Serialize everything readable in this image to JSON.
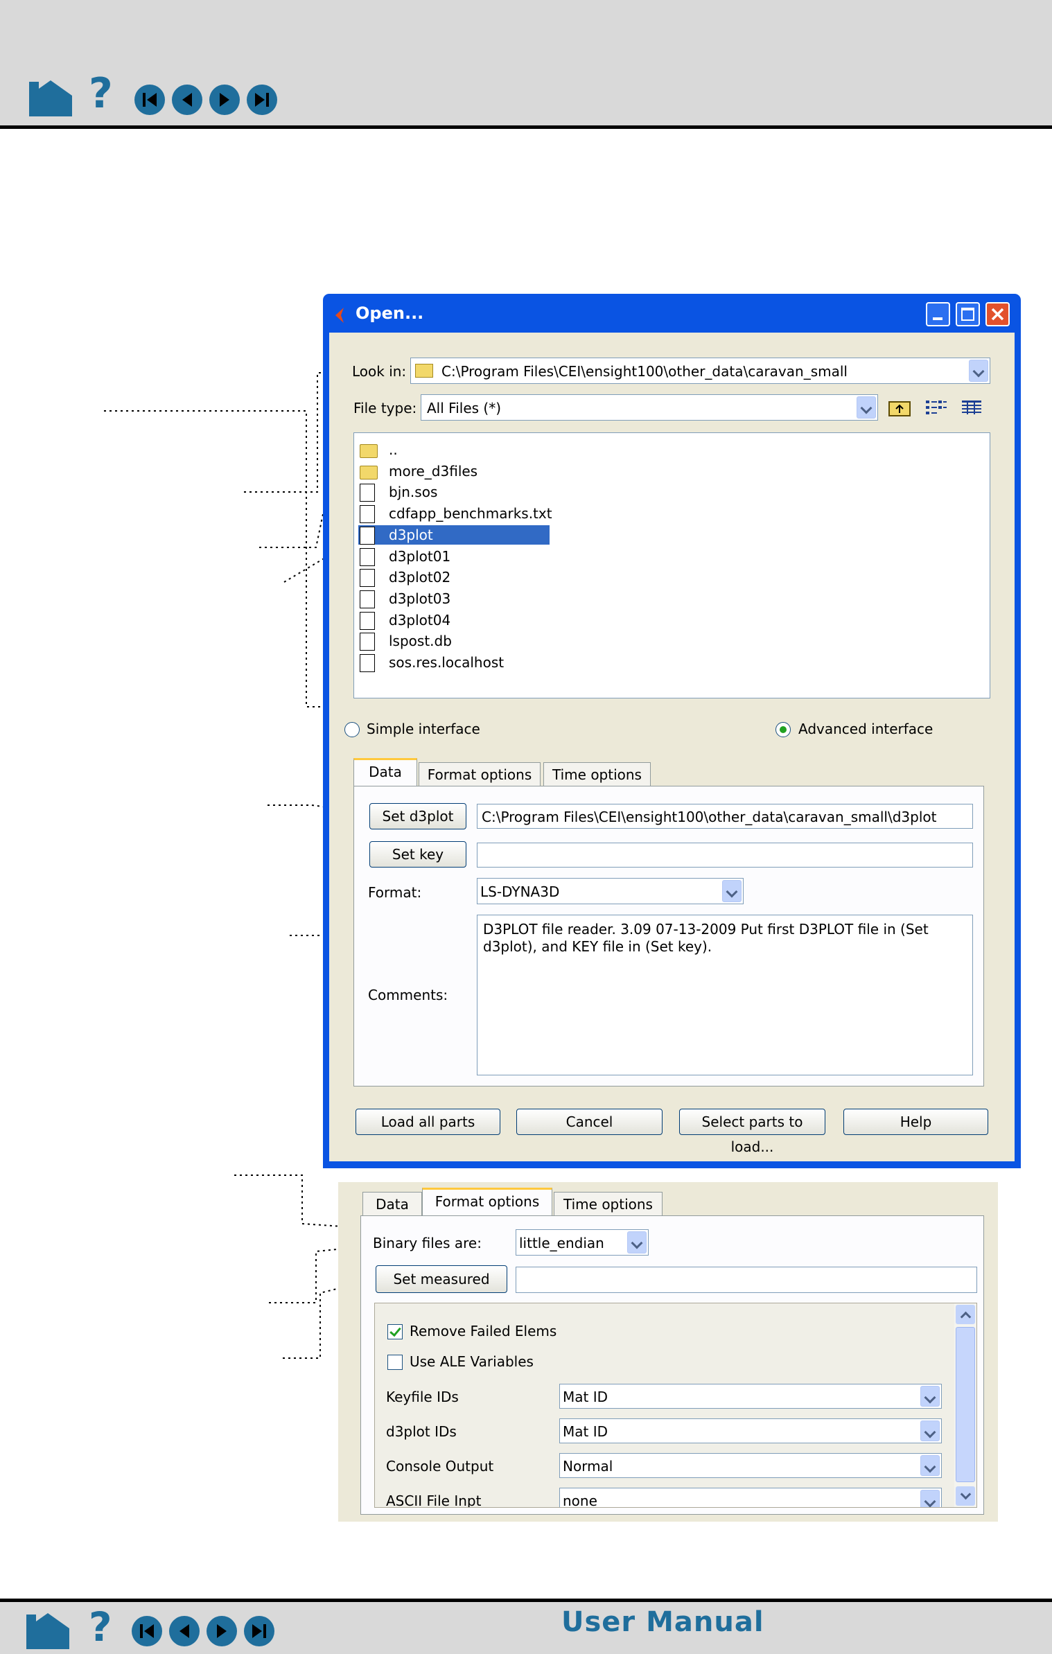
{
  "nav": {
    "icons": [
      "home-icon",
      "help-icon",
      "first-page-icon",
      "prev-page-icon",
      "next-page-icon",
      "last-page-icon"
    ],
    "help_glyph": "?"
  },
  "footer": {
    "title": "User Manual"
  },
  "dialog": {
    "title": "Open...",
    "look_in_label": "Look in:",
    "look_in_value": "C:\\Program Files\\CEI\\ensight100\\other_data\\caravan_small",
    "file_type_label": "File type:",
    "file_type_value": "All Files (*)",
    "files": [
      {
        "name": "..",
        "kind": "folder"
      },
      {
        "name": "more_d3files",
        "kind": "folder"
      },
      {
        "name": "bjn.sos",
        "kind": "file"
      },
      {
        "name": "cdfapp_benchmarks.txt",
        "kind": "file"
      },
      {
        "name": "d3plot",
        "kind": "file",
        "selected": true
      },
      {
        "name": "d3plot01",
        "kind": "file"
      },
      {
        "name": "d3plot02",
        "kind": "file"
      },
      {
        "name": "d3plot03",
        "kind": "file"
      },
      {
        "name": "d3plot04",
        "kind": "file"
      },
      {
        "name": "lspost.db",
        "kind": "file"
      },
      {
        "name": "sos.res.localhost",
        "kind": "file"
      }
    ],
    "simple_interface": "Simple interface",
    "advanced_interface": "Advanced interface",
    "tabs": [
      "Data",
      "Format options",
      "Time options"
    ],
    "set_d3plot_label": "Set d3plot",
    "set_d3plot_value": "C:\\Program Files\\CEI\\ensight100\\other_data\\caravan_small\\d3plot",
    "set_key_label": "Set key",
    "set_key_value": "",
    "format_label": "Format:",
    "format_value": "LS-DYNA3D",
    "comments_label": "Comments:",
    "comments_value": "D3PLOT file reader.  3.09 07-13-2009  Put first D3PLOT file in (Set d3plot), and KEY file in (Set key).",
    "buttons": [
      "Load all parts",
      "Cancel",
      "Select parts to load...",
      "Help"
    ]
  },
  "format_panel": {
    "tabs": [
      "Data",
      "Format options",
      "Time options"
    ],
    "binary_label": "Binary files are:",
    "binary_value": "little_endian",
    "set_measured_label": "Set measured",
    "set_measured_value": "",
    "remove_failed": "Remove Failed Elems",
    "use_ale": "Use ALE Variables",
    "options": [
      {
        "label": "Keyfile IDs",
        "value": "Mat ID"
      },
      {
        "label": "d3plot IDs",
        "value": "Mat ID"
      },
      {
        "label": "Console Output",
        "value": "Normal"
      },
      {
        "label": "ASCII File Inpt",
        "value": "none"
      }
    ]
  }
}
